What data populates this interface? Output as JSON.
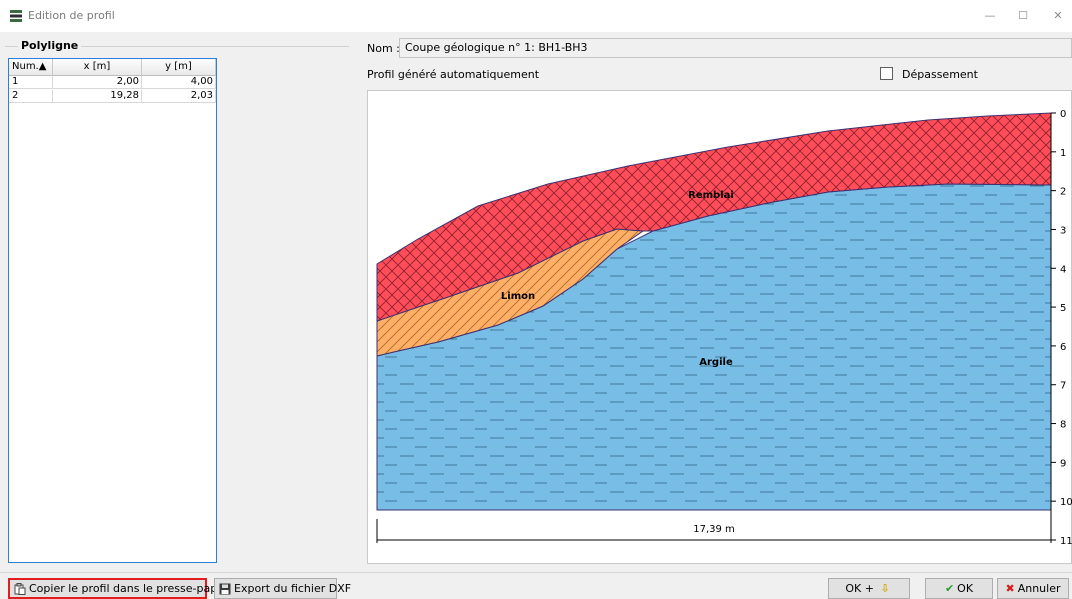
{
  "window": {
    "title": "Edition de profil",
    "min": "—",
    "max": "☐",
    "close": "✕"
  },
  "polyline": {
    "group_title": "Polyligne",
    "headers": {
      "num": "Num.▲",
      "x": "x [m]",
      "y": "y [m]"
    },
    "rows": [
      {
        "num": "1",
        "x": "2,00",
        "y": "4,00"
      },
      {
        "num": "2",
        "x": "19,28",
        "y": "2,03"
      }
    ]
  },
  "nom": {
    "label": "Nom :",
    "value": "Coupe géologique n° 1: BH1-BH3"
  },
  "profile": {
    "label": "Profil généré automatiquement",
    "depassement_label": "Dépassement",
    "depassement_checked": false
  },
  "chart_data": {
    "type": "area",
    "layers": [
      {
        "name": "Remblai",
        "color": "#ff4d5a",
        "pattern": "crosshatch"
      },
      {
        "name": "Limon",
        "color": "#ffb066",
        "pattern": "diagonal"
      },
      {
        "name": "Argile",
        "color": "#78bde6",
        "pattern": "dashes"
      }
    ],
    "y_ticks": [
      "0",
      "1",
      "2",
      "3",
      "4",
      "5",
      "6",
      "7",
      "8",
      "9",
      "10",
      "11"
    ],
    "ylim": [
      0,
      11
    ],
    "width_dimension": "17,39 m"
  },
  "buttons": {
    "copy": "Copier le profil dans le presse-papier",
    "dxf": "Export du fichier DXF",
    "ok_plus": "OK +",
    "ok": "OK",
    "cancel": "Annuler"
  }
}
